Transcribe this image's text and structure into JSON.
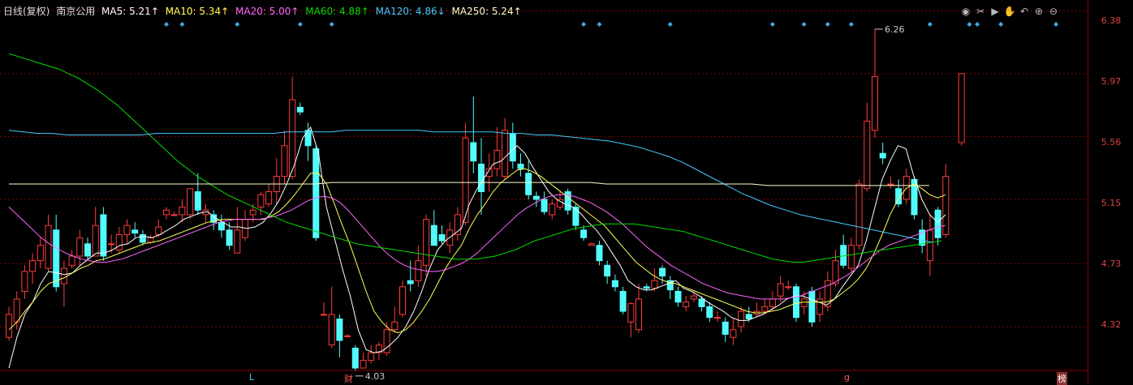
{
  "legend": {
    "period": "日线(复权)",
    "stock": "南京公用",
    "ma5": "MA5: 5.21↑",
    "ma10": "MA10: 5.34↑",
    "ma20": "MA20: 5.00↑",
    "ma60": "MA60: 4.88↑",
    "ma120": "MA120: 4.86↓",
    "ma250": "MA250: 5.24↑"
  },
  "colors": {
    "up": "#ff3b3b",
    "down": "#52fcfc",
    "ma5": "#ffffff",
    "ma10": "#ffff55",
    "ma20": "#ff66ff",
    "ma60": "#00dd00",
    "ma120": "#44ccff",
    "ma250": "#ffffcc",
    "grid": "#8b0000",
    "axis_text": "#e04040"
  },
  "toolbar": [
    "eye-icon",
    "scissors-icon",
    "play-icon",
    "hand-icon",
    "undo-icon",
    "zoom-in-icon",
    "zoom-out-icon"
  ],
  "price_axis": [
    "6.38",
    "5.97",
    "5.56",
    "5.15",
    "4.73",
    "4.32"
  ],
  "annotations": {
    "high": "6.26",
    "low": "4.03"
  },
  "bottom_labels": [
    "L",
    "财",
    "g",
    "榜"
  ],
  "chart_data": {
    "type": "candlestick",
    "ylim": [
      3.95,
      6.45
    ],
    "candles": [
      [
        4.25,
        4.4,
        4.23,
        4.45
      ],
      [
        4.35,
        4.5,
        4.3,
        4.55
      ],
      [
        4.55,
        4.68,
        4.5,
        4.72
      ],
      [
        4.68,
        4.75,
        4.6,
        4.8
      ],
      [
        4.75,
        4.85,
        4.7,
        4.9
      ],
      [
        4.7,
        4.98,
        4.68,
        5.05
      ],
      [
        4.95,
        4.58,
        4.55,
        5.05
      ],
      [
        4.6,
        4.7,
        4.45,
        4.75
      ],
      [
        4.72,
        4.78,
        4.7,
        4.82
      ],
      [
        4.78,
        4.9,
        4.72,
        4.95
      ],
      [
        4.86,
        4.78,
        4.75,
        4.9
      ],
      [
        4.78,
        4.98,
        4.78,
        5.1
      ],
      [
        5.05,
        4.78,
        4.75,
        5.1
      ],
      [
        4.86,
        4.86,
        4.8,
        4.92
      ],
      [
        4.82,
        4.92,
        4.8,
        4.97
      ],
      [
        4.92,
        4.98,
        4.86,
        5.02
      ],
      [
        4.95,
        4.93,
        4.9,
        5.0
      ],
      [
        4.92,
        4.87,
        4.85,
        4.95
      ],
      [
        4.87,
        4.9,
        4.86,
        4.92
      ],
      [
        4.92,
        4.97,
        4.9,
        5.02
      ],
      [
        5.05,
        5.08,
        5.02,
        5.1
      ],
      [
        5.05,
        5.05,
        5.04,
        5.07
      ],
      [
        5.05,
        5.1,
        5.0,
        5.15
      ],
      [
        5.05,
        5.22,
        5.02,
        5.22
      ],
      [
        5.2,
        5.08,
        5.05,
        5.32
      ],
      [
        5.05,
        5.08,
        5.0,
        5.12
      ],
      [
        5.05,
        5.0,
        4.95,
        5.08
      ],
      [
        5.0,
        4.95,
        4.9,
        5.05
      ],
      [
        4.95,
        4.85,
        4.82,
        5.0
      ],
      [
        4.8,
        4.95,
        4.8,
        5.1
      ],
      [
        4.9,
        5.02,
        4.88,
        5.08
      ],
      [
        5.05,
        5.08,
        5.0,
        5.12
      ],
      [
        5.1,
        5.18,
        5.05,
        5.2
      ],
      [
        5.12,
        5.2,
        5.1,
        5.25
      ],
      [
        5.2,
        5.3,
        5.12,
        5.42
      ],
      [
        5.3,
        5.5,
        5.25,
        5.6
      ],
      [
        5.3,
        5.8,
        5.28,
        5.95
      ],
      [
        5.75,
        5.72,
        5.7,
        5.78
      ],
      [
        5.6,
        5.5,
        5.4,
        5.65
      ],
      [
        5.48,
        4.9,
        4.88,
        5.5
      ],
      [
        4.4,
        4.4,
        4.4,
        4.48
      ],
      [
        4.2,
        4.4,
        4.18,
        4.58
      ],
      [
        4.37,
        4.23,
        4.12,
        4.4
      ],
      [
        4.26,
        4.26,
        4.25,
        4.27
      ],
      [
        4.18,
        4.05,
        4.03,
        4.2
      ],
      [
        4.05,
        4.1,
        4.05,
        4.15
      ],
      [
        4.1,
        4.15,
        4.08,
        4.2
      ],
      [
        4.15,
        4.2,
        4.1,
        4.22
      ],
      [
        4.15,
        4.3,
        4.13,
        4.35
      ],
      [
        4.3,
        4.35,
        4.28,
        4.45
      ],
      [
        4.4,
        4.58,
        4.38,
        4.62
      ],
      [
        4.62,
        4.6,
        4.55,
        4.75
      ],
      [
        4.62,
        4.75,
        4.58,
        4.85
      ],
      [
        4.72,
        5.02,
        4.65,
        5.05
      ],
      [
        4.98,
        4.85,
        4.85,
        5.08
      ],
      [
        4.92,
        4.88,
        4.86,
        4.98
      ],
      [
        4.85,
        4.95,
        4.8,
        5.0
      ],
      [
        4.92,
        5.05,
        4.88,
        5.1
      ],
      [
        5.0,
        5.55,
        4.98,
        5.65
      ],
      [
        5.52,
        5.4,
        5.32,
        5.82
      ],
      [
        5.38,
        5.2,
        5.05,
        5.55
      ],
      [
        5.3,
        5.35,
        5.2,
        5.45
      ],
      [
        5.35,
        5.47,
        5.3,
        5.62
      ],
      [
        5.3,
        5.6,
        5.28,
        5.68
      ],
      [
        5.58,
        5.4,
        5.35,
        5.65
      ],
      [
        5.38,
        5.35,
        5.3,
        5.45
      ],
      [
        5.32,
        5.18,
        5.15,
        5.4
      ],
      [
        5.17,
        5.15,
        5.1,
        5.2
      ],
      [
        5.15,
        5.07,
        5.05,
        5.2
      ],
      [
        5.05,
        5.12,
        5.02,
        5.15
      ],
      [
        5.1,
        5.15,
        5.08,
        5.2
      ],
      [
        5.2,
        5.08,
        5.05,
        5.22
      ],
      [
        5.1,
        4.98,
        4.95,
        5.12
      ],
      [
        4.95,
        4.9,
        4.88,
        4.98
      ],
      [
        4.85,
        4.86,
        4.85,
        4.87
      ],
      [
        4.85,
        4.75,
        4.72,
        4.88
      ],
      [
        4.72,
        4.65,
        4.6,
        4.75
      ],
      [
        4.62,
        4.58,
        4.55,
        4.66
      ],
      [
        4.55,
        4.42,
        4.4,
        4.58
      ],
      [
        4.35,
        4.47,
        4.25,
        4.48
      ],
      [
        4.3,
        4.5,
        4.28,
        4.6
      ],
      [
        4.58,
        4.57,
        4.55,
        4.6
      ],
      [
        4.57,
        4.62,
        4.55,
        4.7
      ],
      [
        4.7,
        4.65,
        4.6,
        4.72
      ],
      [
        4.62,
        4.56,
        4.5,
        4.65
      ],
      [
        4.55,
        4.48,
        4.45,
        4.58
      ],
      [
        4.45,
        4.48,
        4.42,
        4.52
      ],
      [
        4.5,
        4.52,
        4.48,
        4.55
      ],
      [
        4.5,
        4.45,
        4.42,
        4.52
      ],
      [
        4.45,
        4.38,
        4.35,
        4.48
      ],
      [
        4.38,
        4.38,
        4.35,
        4.42
      ],
      [
        4.35,
        4.27,
        4.22,
        4.38
      ],
      [
        4.25,
        4.3,
        4.2,
        4.38
      ],
      [
        4.32,
        4.42,
        4.28,
        4.45
      ],
      [
        4.4,
        4.37,
        4.35,
        4.45
      ],
      [
        4.4,
        4.42,
        4.38,
        4.48
      ],
      [
        4.42,
        4.45,
        4.4,
        4.5
      ],
      [
        4.45,
        4.5,
        4.42,
        4.55
      ],
      [
        4.52,
        4.6,
        4.48,
        4.65
      ],
      [
        4.58,
        4.58,
        4.56,
        4.62
      ],
      [
        4.58,
        4.38,
        4.35,
        4.6
      ],
      [
        4.45,
        4.5,
        4.4,
        4.55
      ],
      [
        4.55,
        4.35,
        4.32,
        4.58
      ],
      [
        4.4,
        4.5,
        4.35,
        4.55
      ],
      [
        4.45,
        4.62,
        4.42,
        4.68
      ],
      [
        4.6,
        4.75,
        4.58,
        4.82
      ],
      [
        4.85,
        4.72,
        4.7,
        4.92
      ],
      [
        4.7,
        4.85,
        4.68,
        4.9
      ],
      [
        4.85,
        5.25,
        4.82,
        5.28
      ],
      [
        5.22,
        5.66,
        5.2,
        5.78
      ],
      [
        5.6,
        5.95,
        5.55,
        6.26
      ],
      [
        5.45,
        5.42,
        5.38,
        5.52
      ],
      [
        5.25,
        5.25,
        5.22,
        5.3
      ],
      [
        5.22,
        5.12,
        5.1,
        5.28
      ],
      [
        5.15,
        5.3,
        5.12,
        5.35
      ],
      [
        5.28,
        5.05,
        5.02,
        5.3
      ],
      [
        4.95,
        4.85,
        4.8,
        5.02
      ],
      [
        4.75,
        4.95,
        4.65,
        5.05
      ],
      [
        5.08,
        4.9,
        4.85,
        5.1
      ],
      [
        4.92,
        5.3,
        4.9,
        5.38
      ],
      null,
      [
        5.52,
        5.97,
        5.5,
        5.97
      ]
    ],
    "markers_x": [
      20,
      22,
      29,
      37,
      41,
      73,
      75,
      84,
      97,
      101,
      104,
      107,
      117,
      122,
      123,
      126,
      133
    ],
    "ma_series": {
      "ma5": [
        4.05,
        4.25,
        4.4,
        4.48,
        4.6,
        4.68,
        4.67,
        4.66,
        4.67,
        4.72,
        4.76,
        4.8,
        4.8,
        4.82,
        4.85,
        4.86,
        4.9,
        4.91,
        4.9,
        4.92,
        4.95,
        4.98,
        5.02,
        5.04,
        5.06,
        5.07,
        5.03,
        5.0,
        4.97,
        4.97,
        4.96,
        4.97,
        5.0,
        5.06,
        5.14,
        5.25,
        5.38,
        5.55,
        5.62,
        5.45,
        5.1,
        4.9,
        4.7,
        4.52,
        4.3,
        4.17,
        4.15,
        4.16,
        4.2,
        4.25,
        4.32,
        4.42,
        4.55,
        4.7,
        4.82,
        4.88,
        4.92,
        4.96,
        5.12,
        5.22,
        5.3,
        5.38,
        5.4,
        5.45,
        5.5,
        5.45,
        5.36,
        5.28,
        5.2,
        5.15,
        5.12,
        5.1,
        5.06,
        5.0,
        4.95,
        4.88,
        4.8,
        4.72,
        4.62,
        4.58,
        4.56,
        4.56,
        4.58,
        4.6,
        4.62,
        4.57,
        4.55,
        4.52,
        4.48,
        4.45,
        4.42,
        4.38,
        4.36,
        4.36,
        4.38,
        4.4,
        4.43,
        4.46,
        4.5,
        4.52,
        4.52,
        4.5,
        4.48,
        4.46,
        4.5,
        4.58,
        4.65,
        4.72,
        4.88,
        5.08,
        5.28,
        5.4,
        5.5,
        5.48,
        5.3,
        5.15,
        5.05,
        5.0,
        5.05,
        null,
        5.21
      ],
      "ma10": [
        4.3,
        4.35,
        4.42,
        4.48,
        4.55,
        4.6,
        4.62,
        4.64,
        4.67,
        4.7,
        4.72,
        4.75,
        4.76,
        4.78,
        4.8,
        4.82,
        4.84,
        4.86,
        4.87,
        4.88,
        4.9,
        4.92,
        4.94,
        4.96,
        4.98,
        5.0,
        5.01,
        5.02,
        5.02,
        5.02,
        5.02,
        5.02,
        5.02,
        5.04,
        5.07,
        5.12,
        5.18,
        5.25,
        5.32,
        5.32,
        5.25,
        5.12,
        4.98,
        4.85,
        4.7,
        4.55,
        4.42,
        4.35,
        4.3,
        4.28,
        4.3,
        4.35,
        4.42,
        4.5,
        4.6,
        4.7,
        4.78,
        4.85,
        4.96,
        5.05,
        5.12,
        5.2,
        5.26,
        5.3,
        5.34,
        5.35,
        5.33,
        5.3,
        5.26,
        5.22,
        5.18,
        5.14,
        5.1,
        5.06,
        5.02,
        4.98,
        4.92,
        4.86,
        4.8,
        4.74,
        4.7,
        4.66,
        4.63,
        4.61,
        4.6,
        4.58,
        4.56,
        4.54,
        4.52,
        4.5,
        4.48,
        4.46,
        4.44,
        4.42,
        4.41,
        4.41,
        4.42,
        4.43,
        4.45,
        4.47,
        4.48,
        4.48,
        4.48,
        4.48,
        4.5,
        4.54,
        4.58,
        4.63,
        4.7,
        4.8,
        4.92,
        5.05,
        5.15,
        5.22,
        5.25,
        5.22,
        5.18,
        5.16,
        5.18,
        null,
        5.34
      ],
      "ma20": [
        5.1,
        5.05,
        5.0,
        4.95,
        4.9,
        4.86,
        4.83,
        4.8,
        4.78,
        4.76,
        4.75,
        4.74,
        4.74,
        4.75,
        4.76,
        4.78,
        4.8,
        4.82,
        4.84,
        4.86,
        4.88,
        4.9,
        4.92,
        4.94,
        4.96,
        4.98,
        5.0,
        5.01,
        5.02,
        5.02,
        5.02,
        5.02,
        5.03,
        5.04,
        5.06,
        5.08,
        5.11,
        5.14,
        5.16,
        5.17,
        5.16,
        5.13,
        5.08,
        5.02,
        4.96,
        4.9,
        4.84,
        4.79,
        4.75,
        4.72,
        4.7,
        4.69,
        4.68,
        4.68,
        4.69,
        4.71,
        4.73,
        4.76,
        4.8,
        4.85,
        4.9,
        4.95,
        5.0,
        5.05,
        5.09,
        5.12,
        5.15,
        5.17,
        5.18,
        5.18,
        5.17,
        5.15,
        5.13,
        5.1,
        5.07,
        5.03,
        4.99,
        4.94,
        4.89,
        4.84,
        4.8,
        4.76,
        4.72,
        4.69,
        4.66,
        4.63,
        4.6,
        4.58,
        4.56,
        4.54,
        4.53,
        4.52,
        4.51,
        4.5,
        4.5,
        4.5,
        4.5,
        4.51,
        4.52,
        4.54,
        4.56,
        4.58,
        4.6,
        4.63,
        4.66,
        4.7,
        4.74,
        4.78,
        4.82,
        4.85,
        4.87,
        4.89,
        4.91,
        4.93,
        4.95,
        4.97,
        4.98,
        null,
        5.0
      ],
      "ma60": [
        6.1,
        6.08,
        6.06,
        6.04,
        6.02,
        6.0,
        5.97,
        5.94,
        5.9,
        5.86,
        5.81,
        5.76,
        5.7,
        5.64,
        5.58,
        5.52,
        5.46,
        5.4,
        5.35,
        5.3,
        5.26,
        5.22,
        5.18,
        5.15,
        5.12,
        5.09,
        5.06,
        5.03,
        5.0,
        4.98,
        4.96,
        4.94,
        4.92,
        4.9,
        4.88,
        4.86,
        4.85,
        4.84,
        4.83,
        4.82,
        4.81,
        4.8,
        4.79,
        4.78,
        4.77,
        4.76,
        4.76,
        4.76,
        4.77,
        4.78,
        4.8,
        4.82,
        4.85,
        4.88,
        4.9,
        4.92,
        4.94,
        4.96,
        4.97,
        4.98,
        4.99,
        4.99,
        4.99,
        4.99,
        4.98,
        4.97,
        4.96,
        4.95,
        4.94,
        4.92,
        4.9,
        4.88,
        4.86,
        4.84,
        4.82,
        4.8,
        4.78,
        4.76,
        4.75,
        4.74,
        4.74,
        4.75,
        4.76,
        4.77,
        4.78,
        4.79,
        4.8,
        4.81,
        4.82,
        4.83,
        4.84,
        4.85,
        4.86,
        4.87,
        4.88,
        null,
        4.88
      ],
      "ma120": [
        5.6,
        5.59,
        5.58,
        5.58,
        5.57,
        5.57,
        5.57,
        5.57,
        5.57,
        5.57,
        5.58,
        5.58,
        5.58,
        5.58,
        5.58,
        5.58,
        5.58,
        5.58,
        5.58,
        5.59,
        5.59,
        5.59,
        5.59,
        5.6,
        5.6,
        5.6,
        5.6,
        5.6,
        5.6,
        5.59,
        5.59,
        5.59,
        5.59,
        5.59,
        5.58,
        5.58,
        5.57,
        5.57,
        5.56,
        5.55,
        5.54,
        5.53,
        5.51,
        5.49,
        5.46,
        5.43,
        5.39,
        5.34,
        5.29,
        5.24,
        5.19,
        5.15,
        5.11,
        5.08,
        5.05,
        5.03,
        5.01,
        4.99,
        4.97,
        4.95,
        4.93,
        4.91,
        4.89,
        4.87,
        null,
        4.86
      ],
      "ma250": [
        5.25,
        5.25,
        5.25,
        5.25,
        5.25,
        5.25,
        5.25,
        5.25,
        5.25,
        5.25,
        5.25,
        5.25,
        5.25,
        5.25,
        5.25,
        5.25,
        5.25,
        5.25,
        5.25,
        5.25,
        5.26,
        5.26,
        5.26,
        5.26,
        5.26,
        5.26,
        5.26,
        5.26,
        5.26,
        5.26,
        5.26,
        5.26,
        5.26,
        5.26,
        5.26,
        5.26,
        5.26,
        5.25,
        5.25,
        5.25,
        5.25,
        5.25,
        5.25,
        5.25,
        5.25,
        5.25,
        5.25,
        5.24,
        5.24,
        5.24,
        5.24,
        5.24,
        5.24,
        5.24,
        5.24,
        5.24,
        5.24,
        5.24,
        null,
        5.24
      ]
    }
  }
}
